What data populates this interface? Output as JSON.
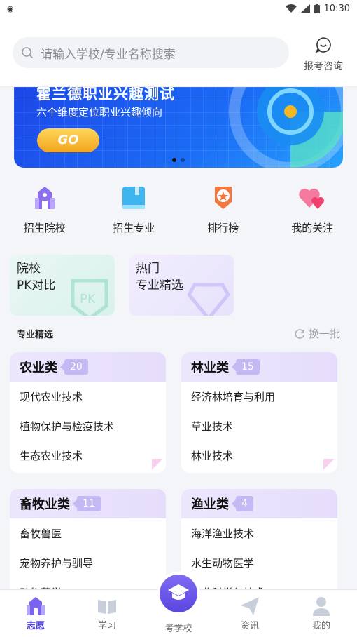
{
  "status": {
    "time": "10:30"
  },
  "search": {
    "placeholder": "请输入学校/专业名称搜索"
  },
  "consult": {
    "label": "报考咨询"
  },
  "banner": {
    "title": "霍兰德职业兴趣测试",
    "subtitle": "六个维度定位职业兴趣倾向",
    "button": "GO"
  },
  "quick": [
    {
      "label": "招生院校",
      "icon": "school-icon"
    },
    {
      "label": "招生专业",
      "icon": "book-icon"
    },
    {
      "label": "排行榜",
      "icon": "ranking-medal-icon"
    },
    {
      "label": "我的关注",
      "icon": "hearts-icon"
    }
  ],
  "cards": {
    "pk": {
      "line1": "院校",
      "line2": "PK对比"
    },
    "hot": {
      "line1": "热门",
      "line2": "专业精选"
    }
  },
  "section": {
    "title": "专业精选",
    "refresh": "换一批"
  },
  "categories": [
    {
      "name": "农业类",
      "count": "20",
      "items": [
        "现代农业技术",
        "植物保护与检疫技术",
        "生态农业技术"
      ]
    },
    {
      "name": "林业类",
      "count": "15",
      "items": [
        "经济林培育与利用",
        "草业技术",
        "林业技术"
      ]
    },
    {
      "name": "畜牧业类",
      "count": "11",
      "items": [
        "畜牧兽医",
        "宠物养护与驯导",
        "动物药学"
      ]
    },
    {
      "name": "渔业类",
      "count": "4",
      "items": [
        "海洋渔业技术",
        "水生动物医学",
        "渔业科学与技术"
      ]
    }
  ],
  "tabs": [
    {
      "label": "志愿",
      "active": true
    },
    {
      "label": "学习"
    },
    {
      "label": "考学校"
    },
    {
      "label": "资讯"
    },
    {
      "label": "我的"
    }
  ],
  "colors": {
    "accent": "#4c3fd6",
    "banner": "#1b6df5",
    "tag": "#c6b8f3"
  }
}
